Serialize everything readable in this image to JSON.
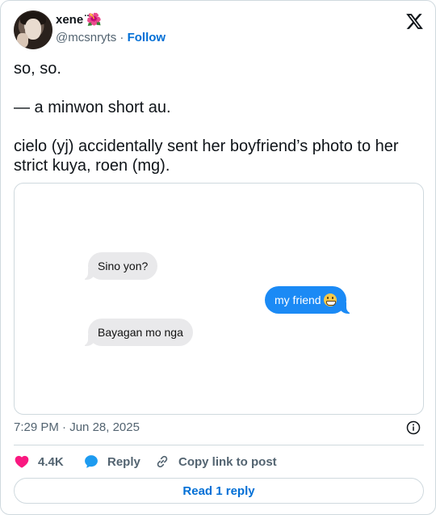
{
  "author": {
    "name": "xene ̈🌺",
    "handle": "@mcsnryts",
    "separator": "·",
    "follow_label": "Follow"
  },
  "tweet": {
    "lines": [
      "so, so.",
      "",
      "— a minwon short au.",
      "",
      "cielo (yj) accidentally sent her boyfriend’s photo to her strict kuya, roen (mg)."
    ]
  },
  "chat": {
    "messages": [
      {
        "direction": "in",
        "text": "Sino yon?"
      },
      {
        "direction": "out",
        "text": "my friend",
        "emoji": "grimacing-face"
      },
      {
        "direction": "in",
        "text": "Bayagan mo nga"
      }
    ],
    "colors": {
      "incoming": "#e9e9eb",
      "outgoing": "#1b8af5"
    }
  },
  "meta": {
    "time": "7:29 PM",
    "separator": "·",
    "date": "Jun 28, 2025"
  },
  "actions": {
    "likes": "4.4K",
    "reply_label": "Reply",
    "copy_label": "Copy link to post"
  },
  "read_replies_label": "Read 1 reply",
  "colors": {
    "accent": "#006fd6",
    "like": "#f91880",
    "reply": "#1d9bf0"
  },
  "icons": [
    "x-logo-icon",
    "heart-icon",
    "reply-bubble-icon",
    "link-icon",
    "info-icon"
  ]
}
